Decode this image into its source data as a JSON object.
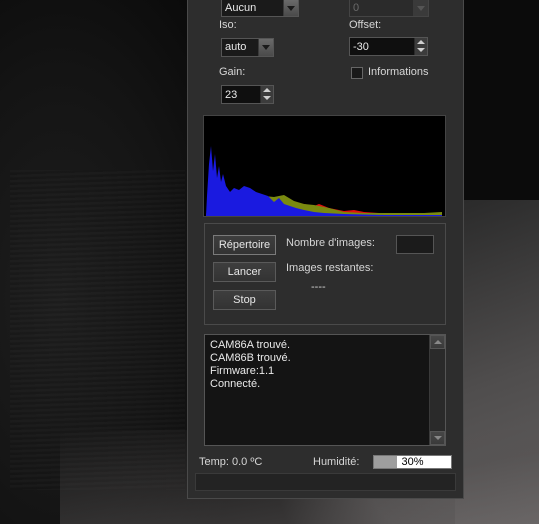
{
  "controls": {
    "binning_select": {
      "value": "Aucun"
    },
    "offset_top_select": {
      "value": "0"
    },
    "iso": {
      "label": "Iso:",
      "value": "auto"
    },
    "offset": {
      "label": "Offset:",
      "value": "-30"
    },
    "gain": {
      "label": "Gain:",
      "value": "23"
    },
    "informations": {
      "label": "Informations",
      "checked": false
    }
  },
  "histogram": {
    "colors": {
      "red": "#e01010",
      "green": "#7a8a10",
      "blue": "#1a1ae0",
      "background": "#000000"
    }
  },
  "capture": {
    "repertoire_button": "Répertoire",
    "lancer_button": "Lancer",
    "stop_button": "Stop",
    "nombre_images_label": "Nombre d'images:",
    "nombre_images_value": "",
    "images_restantes_label": "Images restantes:",
    "images_restantes_value": "----"
  },
  "log": {
    "lines": [
      "CAM86A trouvé.",
      "CAM86B trouvé.",
      "Firmware:1.1",
      "Connecté."
    ]
  },
  "status": {
    "temp": "Temp: 0.0 ºC",
    "humidity_label": "Humidité:",
    "humidity_value": "30%",
    "humidity_fraction": 0.3
  }
}
